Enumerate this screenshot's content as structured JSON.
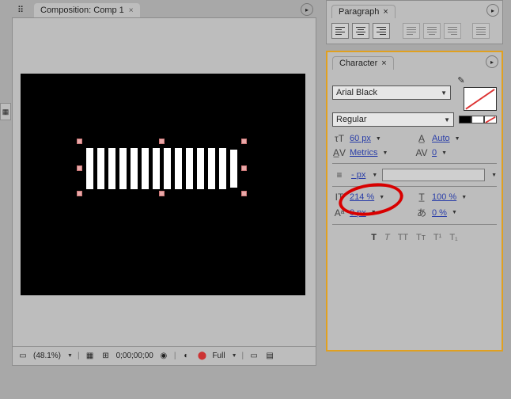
{
  "composition_tab": {
    "label": "Composition: Comp 1",
    "close": "×"
  },
  "status_bar": {
    "zoom": "(48.1%)",
    "timecode": "0;00;00;00",
    "resolution": "Full"
  },
  "paragraph_panel": {
    "tab_label": "Paragraph",
    "close": "×"
  },
  "character_panel": {
    "tab_label": "Character",
    "close": "×",
    "font_family": "Arial Black",
    "font_style": "Regular",
    "font_size_label": "60 px",
    "leading_label": "Auto",
    "kerning_label": "Metrics",
    "tracking_value": "0",
    "stroke_value": "- px",
    "vscale_value": "214 %",
    "hscale_value": "100 %",
    "baseline_value": "0 px",
    "tsume_value": "0 %",
    "style_T": "T",
    "style_I": "T",
    "style_TT": "TT",
    "style_Tt": "Tᴛ",
    "style_Tsup": "T¹",
    "style_Tsub": "T₁"
  },
  "colors": {
    "swatch_black": "#000000",
    "swatch_white": "#ffffff",
    "swatch_none": "none",
    "highlight": "#d80000"
  }
}
